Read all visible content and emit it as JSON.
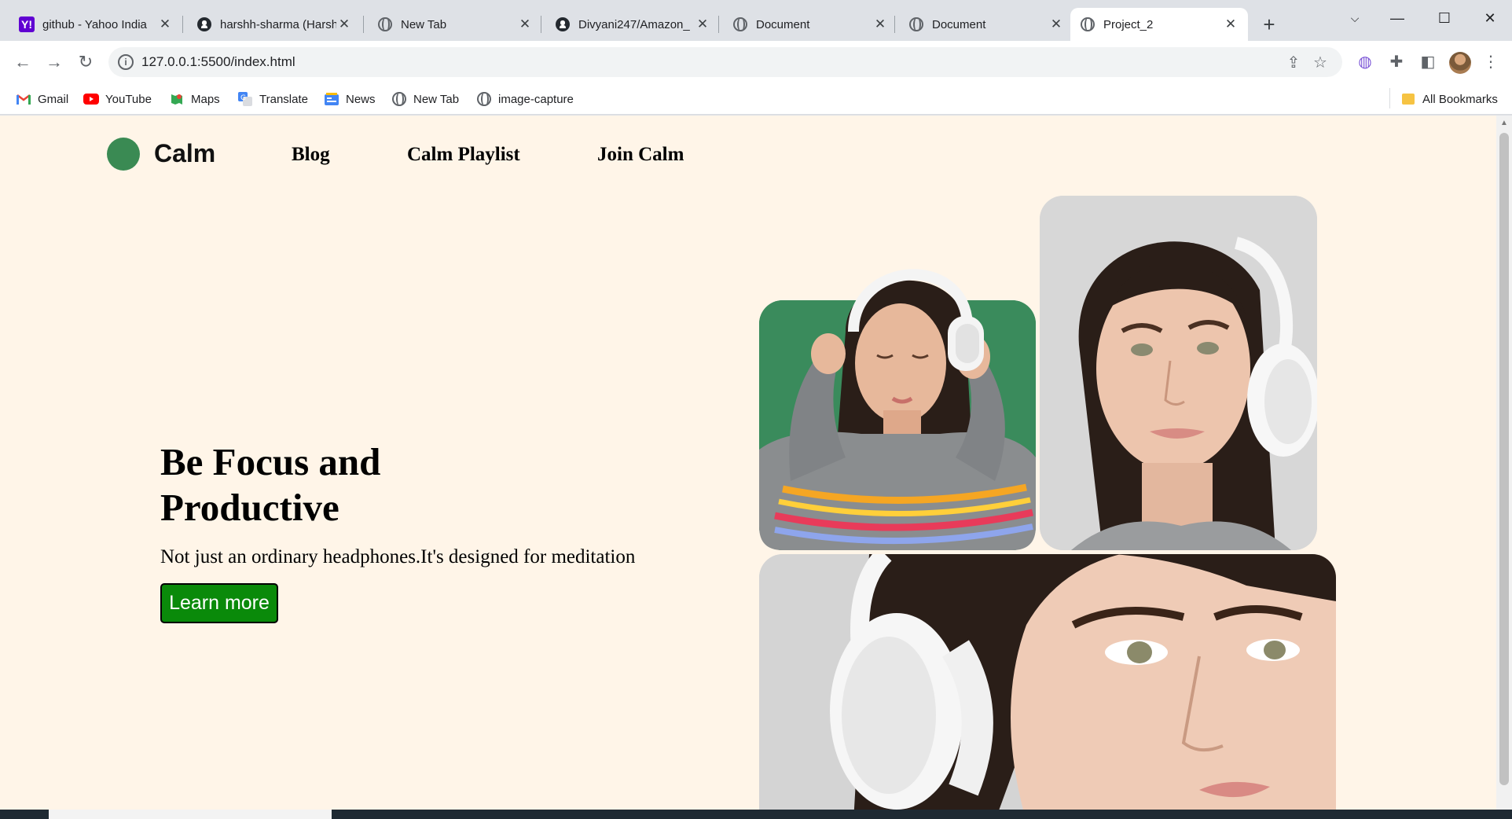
{
  "browser": {
    "tabs": [
      {
        "title": "github - Yahoo India",
        "favicon": "yahoo-icon",
        "active": false
      },
      {
        "title": "harshh-sharma (Harsh",
        "favicon": "github-icon",
        "active": false
      },
      {
        "title": "New Tab",
        "favicon": "globe-icon",
        "active": false
      },
      {
        "title": "Divyani247/Amazon_",
        "favicon": "github-icon",
        "active": false
      },
      {
        "title": "Document",
        "favicon": "globe-icon",
        "active": false
      },
      {
        "title": "Document",
        "favicon": "globe-icon",
        "active": false
      },
      {
        "title": "Project_2",
        "favicon": "globe-icon",
        "active": true
      }
    ],
    "url": "127.0.0.1:5500/index.html",
    "bookmarks": [
      {
        "label": "Gmail",
        "icon": "gmail-icon"
      },
      {
        "label": "YouTube",
        "icon": "youtube-icon"
      },
      {
        "label": "Maps",
        "icon": "maps-icon"
      },
      {
        "label": "Translate",
        "icon": "translate-icon"
      },
      {
        "label": "News",
        "icon": "news-icon"
      },
      {
        "label": "New Tab",
        "icon": "globe-icon"
      },
      {
        "label": "image-capture",
        "icon": "globe-icon"
      }
    ],
    "all_bookmarks": "All Bookmarks",
    "yahoo_glyph": "Y!",
    "colors": {
      "tab_bg": "#dee1e6",
      "page_bg": "#fff5e8",
      "brand_green": "#3a8a53",
      "button_green": "#0a8a0a"
    }
  },
  "site": {
    "logo": "Calm",
    "nav": [
      "Blog",
      "Calm Playlist",
      "Join Calm"
    ],
    "hero": {
      "title_line1": "Be Focus and",
      "title_line2": "Productive",
      "subtitle": "Not just an ordinary headphones.It's designed for meditation",
      "cta": "Learn more"
    }
  }
}
